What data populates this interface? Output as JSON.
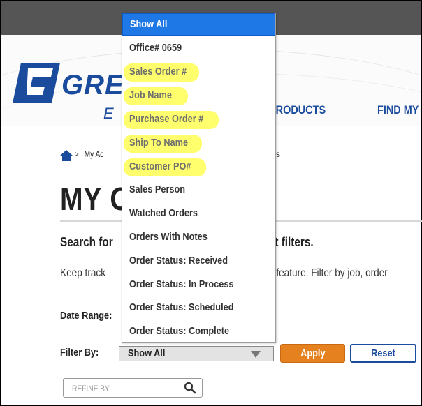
{
  "header": {
    "brand": "GRE",
    "brand_sub": "E",
    "nav_products": "PRODUCTS",
    "nav_find": "FIND MY"
  },
  "breadcrumb": {
    "separator": ">",
    "parent": "My Ac",
    "tail": "s"
  },
  "page": {
    "title": "MY O",
    "search_head": "Search for",
    "search_head_tail": "nt filters.",
    "keep_track": "Keep track",
    "keep_track_tail": "h feature. Filter by job, order",
    "date_range_label": "Date Range:",
    "filter_label": "Filter By:"
  },
  "filter": {
    "selected": "Show All",
    "options": [
      "Show All",
      "Office# 0659",
      "Sales Order #",
      "Job Name",
      "Purchase Order #",
      "Ship To Name",
      "Customer PO#",
      "Sales Person",
      "Watched Orders",
      "Orders With Notes",
      "Order Status: Received",
      "Order Status: In Process",
      "Order Status: Scheduled",
      "Order Status: Complete"
    ]
  },
  "buttons": {
    "apply": "Apply",
    "reset": "Reset"
  },
  "refine": {
    "placeholder": "REFINE BY"
  },
  "colors": {
    "accent_blue": "#1a4b9c",
    "selected_blue": "#1e78e6",
    "apply_orange": "#e5821f",
    "highlight_yellow": "#ffff3c",
    "topbar": "#555555"
  }
}
